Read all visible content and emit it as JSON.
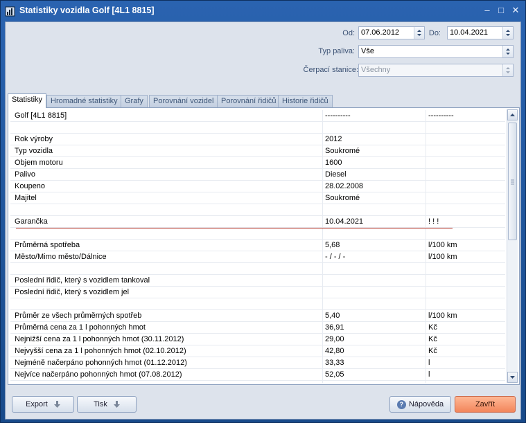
{
  "window": {
    "title": "Statistiky vozidla Golf [4L1 8815]"
  },
  "filters": {
    "from_label": "Od:",
    "from_value": "07.06.2012",
    "to_label": "Do:",
    "to_value": "10.04.2021",
    "fuel_label": "Typ paliva:",
    "fuel_value": "Vše",
    "station_label": "Čerpací stanice:",
    "station_value": "Všechny"
  },
  "tabs": [
    {
      "label": "Statistiky",
      "active": true
    },
    {
      "label": "Hromadné statistiky"
    },
    {
      "label": "Grafy"
    },
    {
      "label": "Porovnání vozidel"
    },
    {
      "label": "Porovnání řidičů"
    },
    {
      "label": "Historie řidičů"
    }
  ],
  "table": {
    "rows": [
      [
        "Golf [4L1 8815]",
        "----------",
        "----------"
      ],
      [
        "",
        "",
        ""
      ],
      [
        "Rok výroby",
        "2012",
        ""
      ],
      [
        "Typ vozidla",
        "Soukromé",
        ""
      ],
      [
        "Objem motoru",
        "1600",
        ""
      ],
      [
        "Palivo",
        "Diesel",
        ""
      ],
      [
        "Koupeno",
        "28.02.2008",
        ""
      ],
      [
        "Majitel",
        "Soukromé",
        ""
      ],
      [
        "",
        "",
        ""
      ],
      [
        "Garančka",
        "10.04.2021",
        "! ! !"
      ],
      [
        "",
        "",
        ""
      ],
      [
        "Průměrná spotřeba",
        "5,68",
        "l/100 km"
      ],
      [
        "Město/Mimo město/Dálnice",
        " - / - / -",
        "l/100 km"
      ],
      [
        "",
        "",
        ""
      ],
      [
        "Poslední řidič, který s vozidlem tankoval",
        "",
        ""
      ],
      [
        "Poslední řidič, který s vozidlem jel",
        "",
        ""
      ],
      [
        "",
        "",
        ""
      ],
      [
        "Průměr ze všech průměrných spotřeb",
        "5,40",
        "l/100 km"
      ],
      [
        "Průměrná cena za 1 l pohonných hmot",
        "36,91",
        "Kč"
      ],
      [
        "Nejnižší cena za 1 l pohonných hmot  (30.11.2012)",
        "29,00",
        "Kč"
      ],
      [
        "Nejvyšší cena za 1 l pohonných hmot  (02.10.2012)",
        "42,80",
        "Kč"
      ],
      [
        "Nejméně načerpáno pohonných hmot  (01.12.2012)",
        "33,33",
        "l"
      ],
      [
        "Nejvíce načerpáno pohonných hmot  (07.08.2012)",
        "52,05",
        "l"
      ]
    ]
  },
  "buttons": {
    "export": "Export",
    "print": "Tisk",
    "help": "Nápověda",
    "close": "Zavřít"
  },
  "colors": {
    "highlight_line": "#b12a1c",
    "close_button": "#f2855b"
  }
}
